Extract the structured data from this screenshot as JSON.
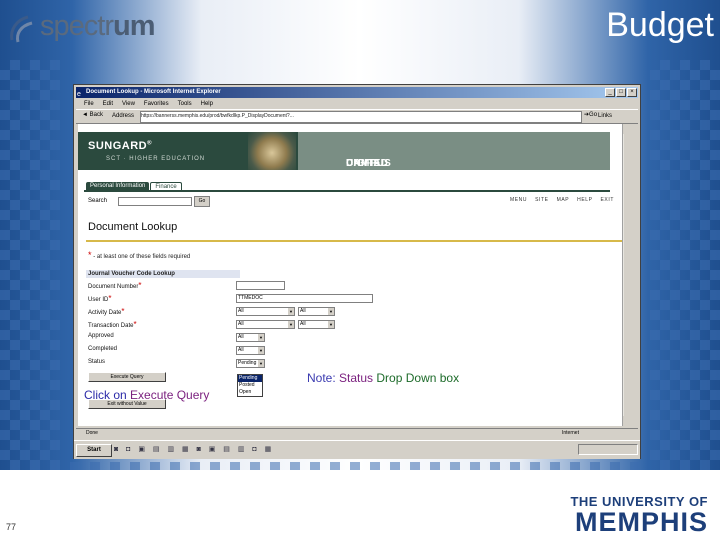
{
  "slide": {
    "title": "Budget",
    "page_number": "77",
    "logo_text_light": "spectr",
    "logo_text_bold": "um",
    "memphis_line1": "THE UNIVERSITY OF",
    "memphis_line2": "MEMPHIS"
  },
  "browser": {
    "window_title": "Document Lookup - Microsoft Internet Explorer",
    "menu": [
      "File",
      "Edit",
      "View",
      "Favorites",
      "Tools",
      "Help"
    ],
    "back_label": "Back",
    "address_label": "Address",
    "address_value": "https://bannerss.memphis.edu/prod/bwfkdlkp.P_DisplayDocument?...",
    "go_label": "Go",
    "links_label": "Links",
    "status_left": "Done",
    "status_zone": "Internet",
    "start_label": "Start",
    "tray_time": ""
  },
  "page": {
    "brand": "SUNGARD",
    "brand_sub": "SCT · HIGHER EDUCATION",
    "udc_light": "UNIFIED",
    "udc_bold": "DIGITAL",
    "udc_tail": "CAMPUS",
    "tabs": [
      "Personal Information",
      "Finance"
    ],
    "search_label": "Search",
    "search_go": "Go",
    "top_links": "MENU  SITE MAP  HELP  EXIT",
    "doc_title": "Document Lookup",
    "required_note": "- at least one of these fields required",
    "section_title": "Journal Voucher Code Lookup",
    "labels": {
      "document_number": "Document Number",
      "user_id": "User ID",
      "activity_date": "Activity Date",
      "transaction_date": "Transaction Date",
      "approved": "Approved",
      "completed": "Completed",
      "status": "Status"
    },
    "values": {
      "user_id": "TTMEDOC",
      "all": "All",
      "status": "Pending"
    },
    "status_options": [
      "Pending",
      "Posted",
      "Open"
    ],
    "execute_button": "Execute Query",
    "exit_button": "Exit without Value"
  },
  "callouts": {
    "click_prefix": "Click on ",
    "click_target": "Execute Query",
    "note_prefix": "Note:  ",
    "note_status": "Status",
    "note_tail": " Drop Down box"
  }
}
